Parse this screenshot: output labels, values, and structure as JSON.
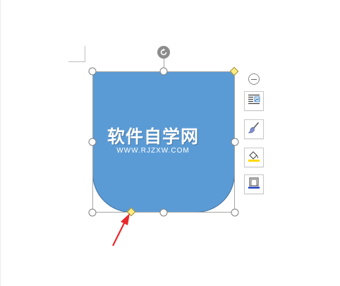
{
  "watermark": {
    "main": "软件自学网",
    "sub": "WWW.RJZXW.COM"
  },
  "colors": {
    "shape_fill": "#5b9bd5",
    "shape_border": "#41719c",
    "adjust_handle": "#ffeb84",
    "arrow": "#e8282b"
  },
  "icons": {
    "layout_options": "text-wrap-icon",
    "shape_style": "brush-icon",
    "fill": "paint-bucket-icon",
    "outline": "shape-outline-icon",
    "collapse": "minus-circle-icon",
    "rotate": "rotate-icon"
  }
}
